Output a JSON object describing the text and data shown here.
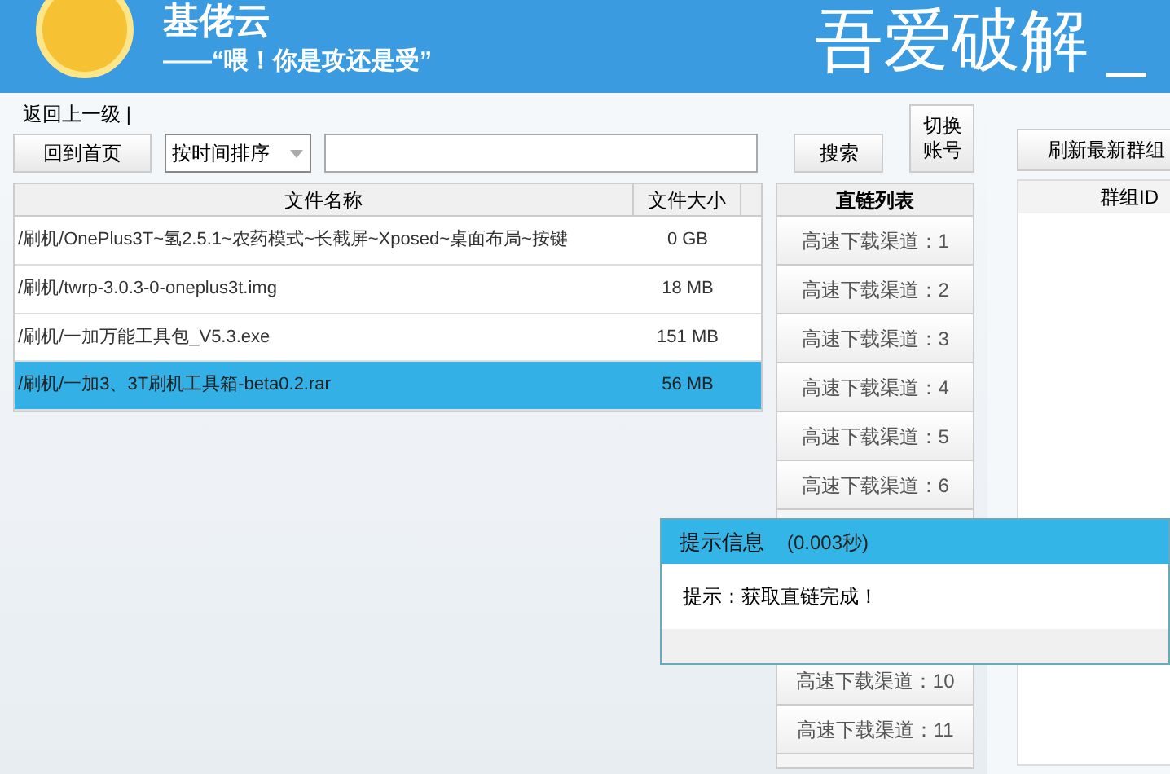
{
  "header": {
    "logo_text": "基佬云",
    "slogan": "——“喂！你是攻还是受”",
    "banner": "吾爱破解 _"
  },
  "toolbar": {
    "path": "返回上一级 |",
    "home_button": "回到首页",
    "sort": "按时间排序",
    "search_button": "搜索",
    "switch_button": "切换账号"
  },
  "files": {
    "columns": [
      "文件名称",
      "文件大小"
    ],
    "rows": [
      {
        "name": "/刷机/OnePlus3T~氢2.5.1~农药模式~长截屏~Xposed~桌面布局~按键",
        "size": "0 GB",
        "selected": false
      },
      {
        "name": "/刷机/twrp-3.0.3-0-oneplus3t.img",
        "size": "18 MB",
        "selected": false
      },
      {
        "name": "/刷机/一加万能工具包_V5.3.exe",
        "size": "151 MB",
        "selected": false
      },
      {
        "name": "/刷机/一加3、3T刷机工具箱-beta0.2.rar",
        "size": "56 MB",
        "selected": true
      }
    ]
  },
  "links": {
    "title": "直链列表",
    "items": [
      "高速下载渠道：1",
      "高速下载渠道：2",
      "高速下载渠道：3",
      "高速下载渠道：4",
      "高速下载渠道：5",
      "高速下载渠道：6",
      "高速下载渠道：10",
      "高速下载渠道：11"
    ]
  },
  "groups": {
    "refresh_button": "刷新最新群组",
    "column": "群组ID"
  },
  "dialog": {
    "title": "提示信息",
    "time": "(0.003秒)",
    "message": "提示：获取直链完成！"
  }
}
